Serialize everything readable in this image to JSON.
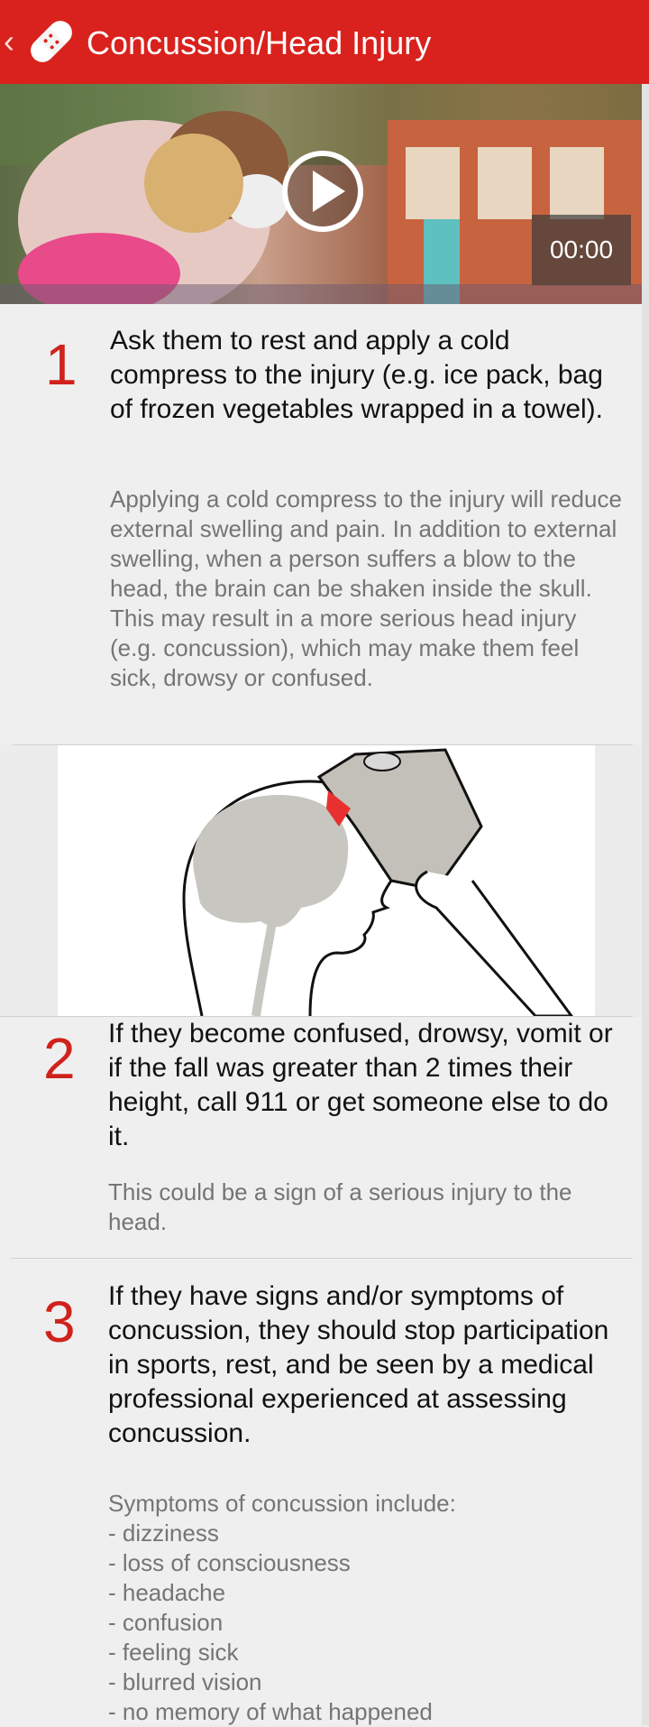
{
  "header": {
    "title": "Concussion/Head Injury",
    "back_icon": "chevron-left-icon",
    "logo_icon": "bandage-icon"
  },
  "video": {
    "time": "00:00",
    "play_icon": "play-icon"
  },
  "steps": [
    {
      "number": "1",
      "heading": "Ask them to rest and apply a cold compress to the injury (e.g. ice pack, bag of frozen vegetables wrapped in a towel).",
      "body": "Applying a cold compress to the injury will reduce external swelling and pain. In addition to external swelling, when a person suffers a blow to the head, the brain can be shaken inside the skull. This may result in a more serious head injury (e.g. concussion), which may make them feel sick, drowsy or confused."
    },
    {
      "number": "2",
      "heading": "If they become confused, drowsy, vomit or if the fall was greater than 2 times their height, call 911 or get someone else to do it.",
      "body": "This could be a sign of a serious injury to the head."
    },
    {
      "number": "3",
      "heading": "If they have signs and/or symptoms of concussion, they should stop participation in sports, rest, and be seen by a medical professional experienced at assessing concussion.",
      "body": "Symptoms of concussion include:\n- dizziness\n- loss of consciousness\n- headache\n- confusion\n- feeling sick\n- blurred vision\n- no memory of what happened"
    }
  ],
  "colors": {
    "brand_red": "#d9221d",
    "step_number": "#d0221c"
  }
}
